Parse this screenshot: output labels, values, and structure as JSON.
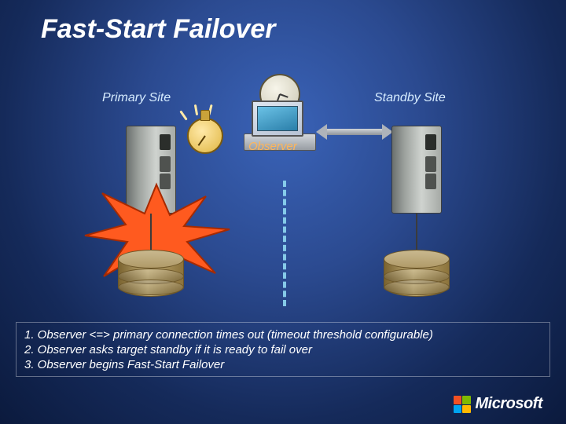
{
  "title": "Fast-Start Failover",
  "labels": {
    "primary": "Primary Site",
    "standby": "Standby Site",
    "observer": "Observer"
  },
  "steps": [
    "1. Observer <=> primary connection times out (timeout threshold configurable)",
    "2. Observer asks target standby if it is ready to fail over",
    "3. Observer begins Fast-Start Failover"
  ],
  "branding": {
    "company": "Microsoft"
  },
  "icons": {
    "clock": "clock-icon",
    "stopwatch": "stopwatch-icon",
    "monitor": "monitor-icon",
    "server": "server-icon",
    "database": "database-cylinder-icon",
    "explosion": "explosion-burst-icon",
    "double_arrow": "double-arrow-icon"
  },
  "colors": {
    "background_gradient": [
      "#3a63b8",
      "#152a5a"
    ],
    "accent_orange": "#ffb65a",
    "dash_cyan": "#8fd8f2"
  }
}
